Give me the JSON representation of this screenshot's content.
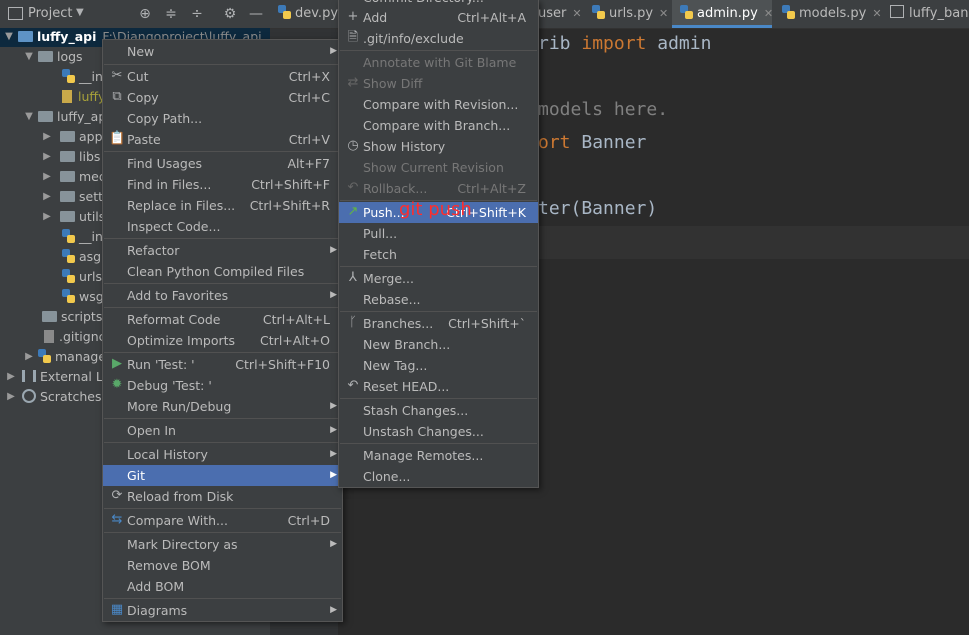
{
  "project_panel": {
    "title": "Project",
    "tree": [
      {
        "label": "luffy_api",
        "path": "F:\\Djangoproject\\luffy_api"
      },
      {
        "label": "logs"
      },
      {
        "label": "__ini"
      },
      {
        "label": "luffy"
      },
      {
        "label": "luffy_ap"
      },
      {
        "label": "app"
      },
      {
        "label": "libs"
      },
      {
        "label": "med"
      },
      {
        "label": "setti"
      },
      {
        "label": "utils"
      },
      {
        "label": "__ini"
      },
      {
        "label": "asgi"
      },
      {
        "label": "urls."
      },
      {
        "label": "wsg"
      },
      {
        "label": "scripts"
      },
      {
        "label": ".gitignc"
      },
      {
        "label": "manage"
      },
      {
        "label": "External Li"
      },
      {
        "label": "Scratches a"
      }
    ]
  },
  "tabs": [
    {
      "label": "dev.py"
    },
    {
      "label": "user"
    },
    {
      "label": "urls.py"
    },
    {
      "label": "admin.py"
    },
    {
      "label": "models.py"
    },
    {
      "label": "luffy_bann"
    }
  ],
  "editor": {
    "line1_a": "rib ",
    "line1_kw": "import",
    "line1_b": " admin",
    "line2": "models here.",
    "line3_kw": "ort",
    "line3_b": " Banner",
    "line4": "ter(Banner)"
  },
  "context_menu": {
    "items": [
      {
        "label": "New",
        "shortcut": ""
      },
      {
        "label": "Cut",
        "shortcut": "Ctrl+X"
      },
      {
        "label": "Copy",
        "shortcut": "Ctrl+C"
      },
      {
        "label": "Copy Path...",
        "shortcut": ""
      },
      {
        "label": "Paste",
        "shortcut": "Ctrl+V"
      },
      {
        "label": "Find Usages",
        "shortcut": "Alt+F7"
      },
      {
        "label": "Find in Files...",
        "shortcut": "Ctrl+Shift+F"
      },
      {
        "label": "Replace in Files...",
        "shortcut": "Ctrl+Shift+R"
      },
      {
        "label": "Inspect Code...",
        "shortcut": ""
      },
      {
        "label": "Refactor",
        "shortcut": ""
      },
      {
        "label": "Clean Python Compiled Files",
        "shortcut": ""
      },
      {
        "label": "Add to Favorites",
        "shortcut": ""
      },
      {
        "label": "Reformat Code",
        "shortcut": "Ctrl+Alt+L"
      },
      {
        "label": "Optimize Imports",
        "shortcut": "Ctrl+Alt+O"
      },
      {
        "label": "Run 'Test: '",
        "shortcut": "Ctrl+Shift+F10"
      },
      {
        "label": "Debug 'Test: '",
        "shortcut": ""
      },
      {
        "label": "More Run/Debug",
        "shortcut": ""
      },
      {
        "label": "Open In",
        "shortcut": ""
      },
      {
        "label": "Local History",
        "shortcut": ""
      },
      {
        "label": "Git",
        "shortcut": ""
      },
      {
        "label": "Reload from Disk",
        "shortcut": ""
      },
      {
        "label": "Compare With...",
        "shortcut": "Ctrl+D"
      },
      {
        "label": "Mark Directory as",
        "shortcut": ""
      },
      {
        "label": "Remove BOM",
        "shortcut": ""
      },
      {
        "label": "Add BOM",
        "shortcut": ""
      },
      {
        "label": "Diagrams",
        "shortcut": ""
      }
    ]
  },
  "git_menu": {
    "cut_top": "Commit Directory...",
    "items": [
      {
        "label": "Add",
        "shortcut": "Ctrl+Alt+A"
      },
      {
        "label": ".git/info/exclude",
        "shortcut": ""
      },
      {
        "label": "Annotate with Git Blame",
        "shortcut": ""
      },
      {
        "label": "Show Diff",
        "shortcut": ""
      },
      {
        "label": "Compare with Revision...",
        "shortcut": ""
      },
      {
        "label": "Compare with Branch...",
        "shortcut": ""
      },
      {
        "label": "Show History",
        "shortcut": ""
      },
      {
        "label": "Show Current Revision",
        "shortcut": ""
      },
      {
        "label": "Rollback...",
        "shortcut": "Ctrl+Alt+Z"
      },
      {
        "label": "Push...",
        "shortcut": "Ctrl+Shift+K"
      },
      {
        "label": "Pull...",
        "shortcut": ""
      },
      {
        "label": "Fetch",
        "shortcut": ""
      },
      {
        "label": "Merge...",
        "shortcut": ""
      },
      {
        "label": "Rebase...",
        "shortcut": ""
      },
      {
        "label": "Branches...",
        "shortcut": "Ctrl+Shift+`"
      },
      {
        "label": "New Branch...",
        "shortcut": ""
      },
      {
        "label": "New Tag...",
        "shortcut": ""
      },
      {
        "label": "Reset HEAD...",
        "shortcut": ""
      },
      {
        "label": "Stash Changes...",
        "shortcut": ""
      },
      {
        "label": "Unstash Changes...",
        "shortcut": ""
      },
      {
        "label": "Manage Remotes...",
        "shortcut": ""
      },
      {
        "label": "Clone...",
        "shortcut": ""
      }
    ]
  },
  "annotation": "git push",
  "colors": {
    "highlight": "#4b6eaf",
    "annotation": "#ff2d2d",
    "keyword": "#cc7832"
  }
}
